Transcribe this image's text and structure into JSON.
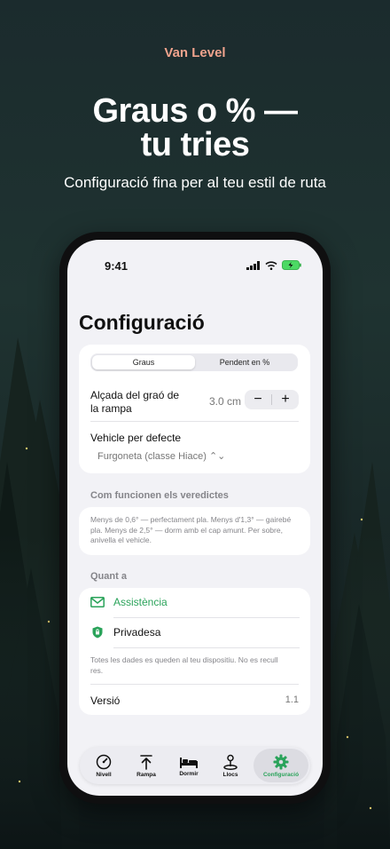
{
  "app_name": "Van Level",
  "headline_line1": "Graus o % —",
  "headline_line2": "tu tries",
  "subheadline": "Configuració fina per al teu estil de ruta",
  "status_bar": {
    "time": "9:41"
  },
  "screen": {
    "title": "Configuració",
    "unit_segment": {
      "options": [
        "Graus",
        "Pendent en %"
      ],
      "selected": "Graus"
    },
    "ramp": {
      "label": "Alçada del graó de la rampa",
      "value": "3.0 cm",
      "minus": "−",
      "plus": "+"
    },
    "vehicle": {
      "label": "Vehicle per defecte",
      "value": "Furgoneta (classe Hiace) ⌃⌄"
    },
    "verdicts": {
      "header": "Com funcionen els veredictes",
      "text": "Menys de 0,6° — perfectament pla. Menys d'1,3° — gairebé pla. Menys de 2,5° — dorm amb el cap amunt. Per sobre, anivella el vehicle."
    },
    "about": {
      "header": "Quant a",
      "support": "Assistència",
      "privacy": "Privadesa",
      "privacy_note": "Totes les dades es queden al teu dispositiu. No es recull res.",
      "version_label": "Versió",
      "version_value": "1.1"
    },
    "tabs": [
      {
        "label": "Nivell",
        "icon": "gauge-icon"
      },
      {
        "label": "Rampa",
        "icon": "arrow-up-bar-icon"
      },
      {
        "label": "Dormir",
        "icon": "bed-icon"
      },
      {
        "label": "Llocs",
        "icon": "map-pin-icon"
      },
      {
        "label": "Configuració",
        "icon": "gear-icon",
        "active": true
      }
    ]
  },
  "colors": {
    "accent": "#2aa35a",
    "app_name": "#f0a38d"
  }
}
